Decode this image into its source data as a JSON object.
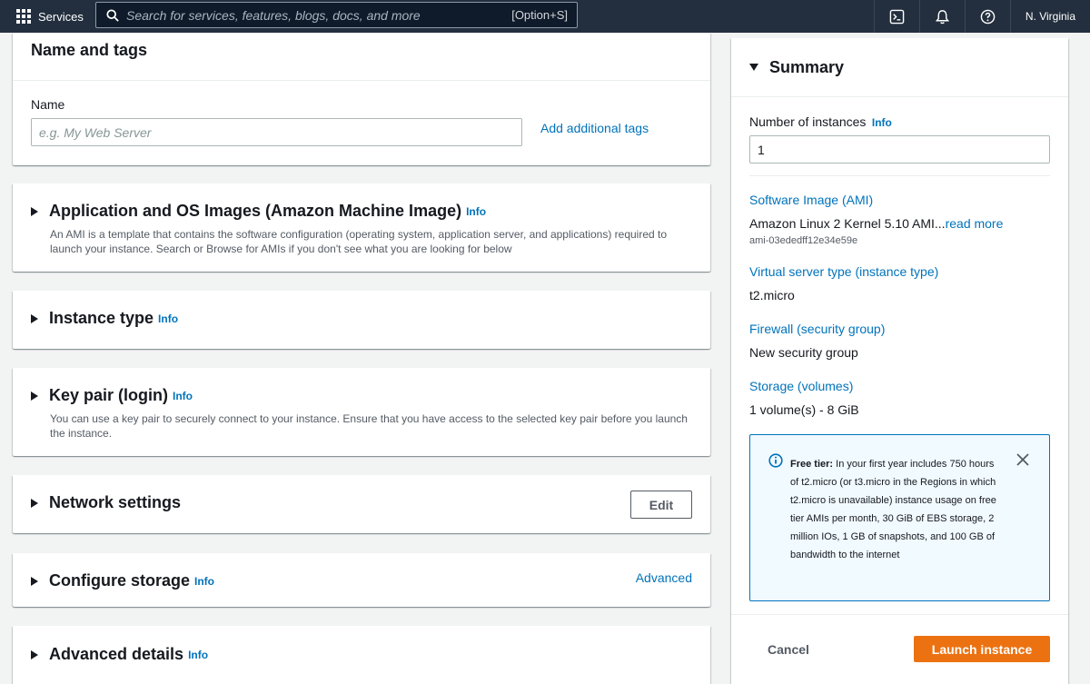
{
  "topnav": {
    "services_label": "Services",
    "search_placeholder": "Search for services, features, blogs, docs, and more",
    "search_shortcut": "[Option+S]",
    "icons": [
      "cloudshell-icon",
      "bell-icon",
      "help-icon"
    ],
    "region": "N. Virginia"
  },
  "name_tags": {
    "title": "Name and tags",
    "name_label": "Name",
    "name_placeholder": "e.g. My Web Server",
    "add_tags": "Add additional tags"
  },
  "sections": {
    "ami": {
      "title": "Application and OS Images (Amazon Machine Image)",
      "info": "Info",
      "desc": "An AMI is a template that contains the software configuration (operating system, application server, and applications) required to launch your instance. Search or Browse for AMIs if you don't see what you are looking for below"
    },
    "instance_type": {
      "title": "Instance type",
      "info": "Info"
    },
    "key_pair": {
      "title": "Key pair (login)",
      "info": "Info",
      "desc": "You can use a key pair to securely connect to your instance. Ensure that you have access to the selected key pair before you launch the instance."
    },
    "network": {
      "title": "Network settings",
      "edit": "Edit"
    },
    "storage": {
      "title": "Configure storage",
      "info": "Info",
      "advanced": "Advanced"
    },
    "advanced": {
      "title": "Advanced details",
      "info": "Info"
    }
  },
  "summary": {
    "title": "Summary",
    "instances_label": "Number of instances",
    "instances_info": "Info",
    "instances_value": "1",
    "ami_label": "Software Image (AMI)",
    "ami_value": "Amazon Linux 2 Kernel 5.10 AMI...",
    "ami_read_more": "read more",
    "ami_id": "ami-03ededff12e34e59e",
    "instance_type_label": "Virtual server type (instance type)",
    "instance_type_value": "t2.micro",
    "firewall_label": "Firewall (security group)",
    "firewall_value": "New security group",
    "storage_label": "Storage (volumes)",
    "storage_value": "1 volume(s) - 8 GiB",
    "free_tier_bold": "Free tier:",
    "free_tier_text": " In your first year includes 750 hours of t2.micro (or t3.micro in the Regions in which t2.micro is unavailable) instance usage on free tier AMIs per month, 30 GiB of EBS storage, 2 million IOs, 1 GB of snapshots, and 100 GB of bandwidth to the internet",
    "cancel": "Cancel",
    "launch": "Launch instance"
  },
  "colors": {
    "nav_bg": "#232f3e",
    "link": "#0073bb",
    "primary": "#ec7211",
    "free_tier_bg": "#f1faff"
  }
}
